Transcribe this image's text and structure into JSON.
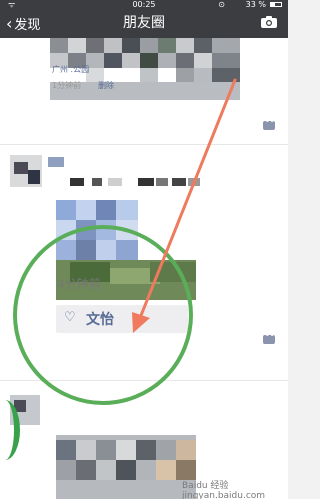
{
  "status_bar": {
    "signal": "ᯤ",
    "time": "00:25",
    "lock": "⊙",
    "battery": "33 %"
  },
  "nav": {
    "back_label": "发现",
    "title": "朋友圈"
  },
  "post1": {
    "location": "广州  .公园",
    "time": "1分钟前",
    "delete": "删除"
  },
  "post2": {
    "time": "4分钟前",
    "like_heart": "♡",
    "liker": "文怡"
  },
  "watermark": "Baidu 经验 jingyan.baidu.com",
  "colors": {
    "nav_bg": "#3b3d41",
    "link": "#576b95",
    "circle": "#5aae59",
    "arrow": "#f07a5e"
  }
}
